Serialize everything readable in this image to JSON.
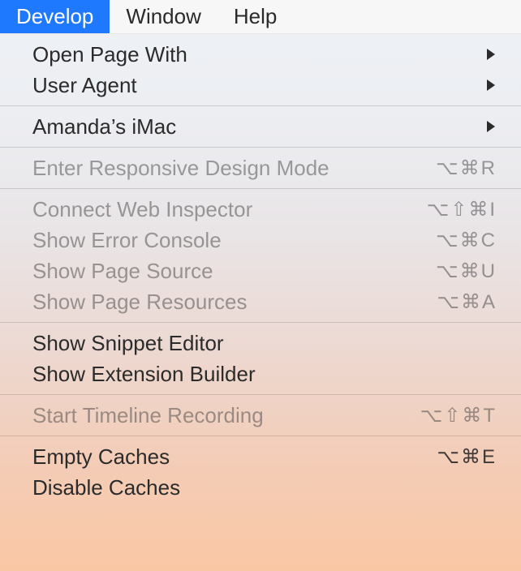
{
  "menubar": {
    "items": [
      {
        "label": "Develop",
        "active": true
      },
      {
        "label": "Window",
        "active": false
      },
      {
        "label": "Help",
        "active": false
      }
    ]
  },
  "menu": {
    "sections": [
      [
        {
          "label": "Open Page With",
          "submenu": true,
          "disabled": false,
          "shortcut": ""
        },
        {
          "label": "User Agent",
          "submenu": true,
          "disabled": false,
          "shortcut": ""
        }
      ],
      [
        {
          "label": "Amanda’s iMac",
          "submenu": true,
          "disabled": false,
          "shortcut": ""
        }
      ],
      [
        {
          "label": "Enter Responsive Design Mode",
          "submenu": false,
          "disabled": true,
          "shortcut": "⌥⌘R"
        }
      ],
      [
        {
          "label": "Connect Web Inspector",
          "submenu": false,
          "disabled": true,
          "shortcut": "⌥⇧⌘I"
        },
        {
          "label": "Show Error Console",
          "submenu": false,
          "disabled": true,
          "shortcut": "⌥⌘C"
        },
        {
          "label": "Show Page Source",
          "submenu": false,
          "disabled": true,
          "shortcut": "⌥⌘U"
        },
        {
          "label": "Show Page Resources",
          "submenu": false,
          "disabled": true,
          "shortcut": "⌥⌘A"
        }
      ],
      [
        {
          "label": "Show Snippet Editor",
          "submenu": false,
          "disabled": false,
          "shortcut": ""
        },
        {
          "label": "Show Extension Builder",
          "submenu": false,
          "disabled": false,
          "shortcut": ""
        }
      ],
      [
        {
          "label": "Start Timeline Recording",
          "submenu": false,
          "disabled": true,
          "shortcut": "⌥⇧⌘T"
        }
      ],
      [
        {
          "label": "Empty Caches",
          "submenu": false,
          "disabled": false,
          "shortcut": "⌥⌘E"
        },
        {
          "label": "Disable Caches",
          "submenu": false,
          "disabled": false,
          "shortcut": ""
        }
      ]
    ]
  }
}
